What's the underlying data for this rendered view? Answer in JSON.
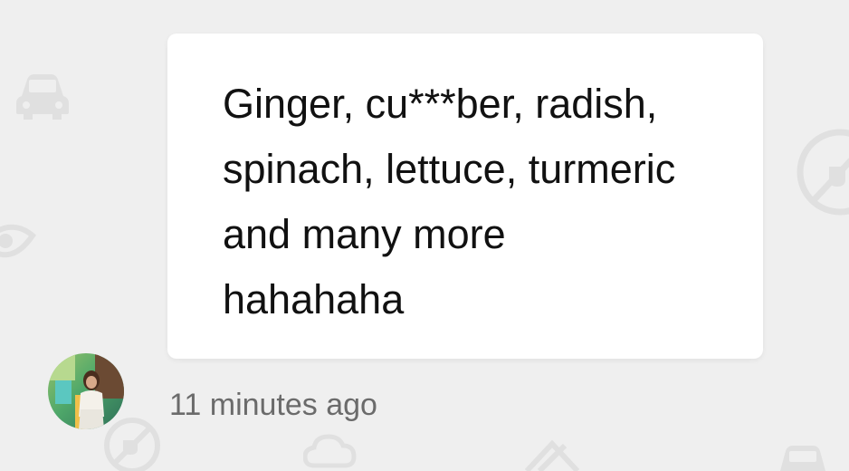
{
  "message": {
    "lines": [
      "Ginger, cu***ber, radish,",
      "spinach, lettuce, turmeric",
      "and many more",
      "hahahaha"
    ],
    "timestamp": "11 minutes ago"
  },
  "background_icons": [
    "car-icon",
    "no-plug-icon",
    "eye-icon",
    "cloud-icon",
    "car-icon"
  ],
  "colors": {
    "background": "#efefef",
    "bubble": "#ffffff",
    "text": "#111111",
    "timestamp": "#6b6b6b"
  }
}
